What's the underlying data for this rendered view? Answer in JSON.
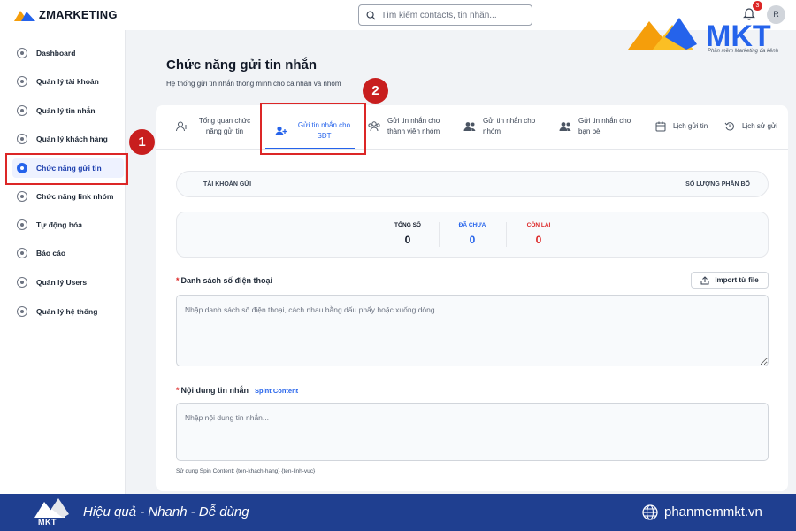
{
  "topbar": {
    "logo_text": "ZMARKETING",
    "search_placeholder": "Tìm kiếm contacts, tin nhắn...",
    "notification_count": "3",
    "avatar_initial": "R"
  },
  "brand": {
    "name": "MKT",
    "tagline": "Phần mềm Marketing đa kênh"
  },
  "sidebar": {
    "items": [
      {
        "label": "Dashboard",
        "icon": "dashboard-icon"
      },
      {
        "label": "Quản lý tài khoản",
        "icon": "account-icon"
      },
      {
        "label": "Quản lý tin nhắn",
        "icon": "message-icon"
      },
      {
        "label": "Quản lý khách hàng",
        "icon": "customer-icon"
      },
      {
        "label": "Chức năng gửi tin",
        "icon": "send-icon",
        "active": true
      },
      {
        "label": "Chức năng link nhóm",
        "icon": "link-icon"
      },
      {
        "label": "Tự động hóa",
        "icon": "automation-icon"
      },
      {
        "label": "Báo cáo",
        "icon": "report-icon"
      },
      {
        "label": "Quản lý Users",
        "icon": "users-icon"
      },
      {
        "label": "Quản lý hệ thống",
        "icon": "settings-icon"
      }
    ]
  },
  "callouts": {
    "one": "1",
    "two": "2"
  },
  "main": {
    "title": "Chức năng gửi tin nhắn",
    "subtitle": "Hệ thống gửi tin nhắn thông minh cho cá nhân và nhóm"
  },
  "tabs": [
    {
      "label": "Tổng quan chức năng gửi tin",
      "icon": "user-plus-icon"
    },
    {
      "label": "Gửi tin nhắn cho SĐT",
      "icon": "user-plus-icon",
      "active": true
    },
    {
      "label": "Gửi tin nhắn cho thành viên nhóm",
      "icon": "group-members-icon"
    },
    {
      "label": "Gửi tin nhắn cho nhóm",
      "icon": "users-group-icon"
    },
    {
      "label": "Gửi tin nhắn cho bạn bè",
      "icon": "friends-icon"
    },
    {
      "label": "Lịch gửi tin",
      "icon": "calendar-icon"
    },
    {
      "label": "Lịch sử gửi",
      "icon": "history-icon"
    }
  ],
  "account_bar": {
    "left_label": "TÀI KHOẢN GỬI",
    "right_label": "SỐ LƯỢNG PHÂN BỔ"
  },
  "stats": [
    {
      "label": "TỔNG SỐ",
      "value": "0",
      "color": "#111827"
    },
    {
      "label": "ĐÃ CHƯA",
      "value": "0",
      "color": "#2563eb"
    },
    {
      "label": "CÒN LẠI",
      "value": "0",
      "color": "#dc2626"
    }
  ],
  "phone_list": {
    "label": "Danh sách số điện thoại",
    "required_mark": "*",
    "import_button": "Import từ file",
    "placeholder": "Nhập danh sách số điện thoại, cách nhau bằng dấu phẩy hoặc xuống dòng..."
  },
  "message": {
    "label": "Nội dung tin nhắn",
    "required_mark": "*",
    "spint_link": "Spint Content",
    "placeholder": "Nhập nội dung tin nhắn...",
    "hint": "Sử dụng Spin Content: {ten-khach-hang} {ten-linh-vuc}"
  },
  "footer": {
    "logo_text": "MKT",
    "slogan": "Hiệu quả - Nhanh - Dễ dùng",
    "website": "phanmemmkt.vn"
  },
  "colors": {
    "accent": "#2563eb",
    "highlight": "#dc2626",
    "footer_bg": "#1f3f90",
    "brand_orange": "#f59e0b",
    "brand_blue": "#2563eb"
  }
}
